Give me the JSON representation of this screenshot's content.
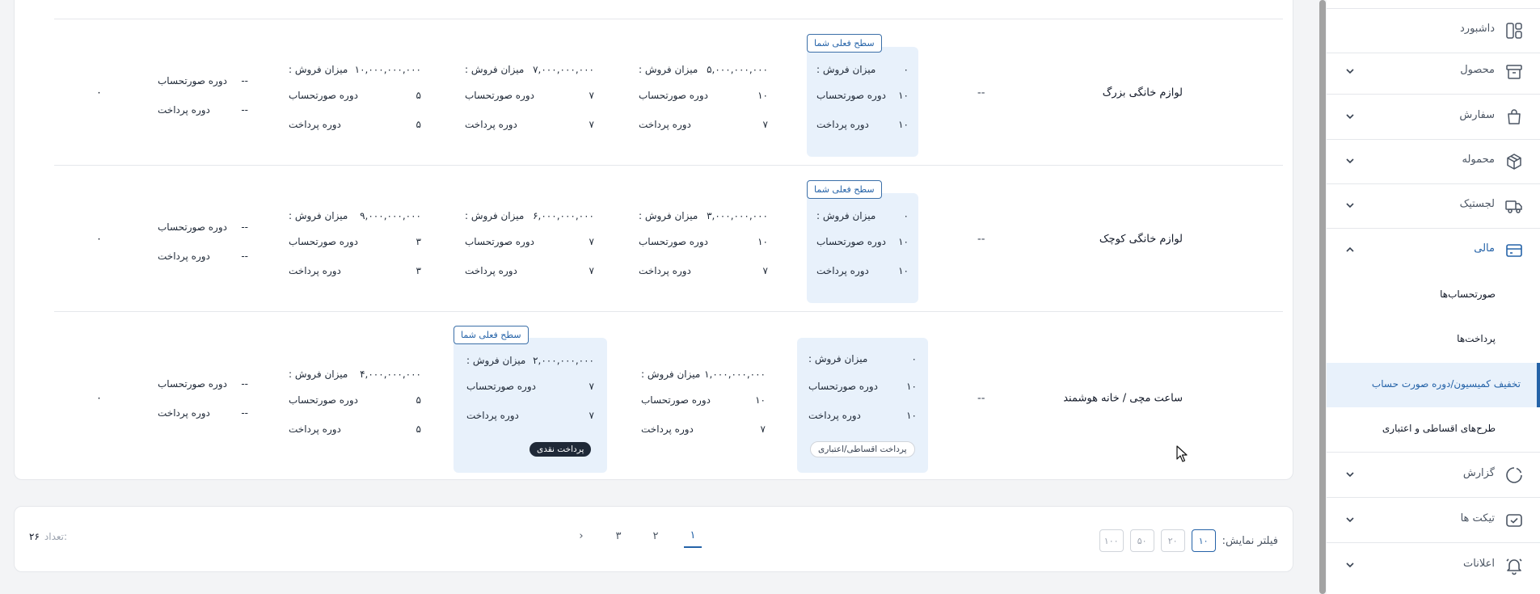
{
  "sidebar": {
    "items": [
      {
        "label": "داشبورد",
        "icon": "dashboard-icon"
      },
      {
        "label": "محصول",
        "icon": "product-icon"
      },
      {
        "label": "سفارش",
        "icon": "order-bag-icon"
      },
      {
        "label": "محموله",
        "icon": "package-icon"
      },
      {
        "label": "لجستیک",
        "icon": "truck-icon"
      },
      {
        "label": "مالی",
        "icon": "wallet-icon"
      }
    ],
    "finance_sub": [
      {
        "label": "صورتحساب‌ها"
      },
      {
        "label": "پرداخت‌ها"
      },
      {
        "label": "تخفیف کمیسیون/دوره صورت حساب"
      },
      {
        "label": "طرح‌های اقساطی و اعتباری"
      }
    ],
    "bottom_items": [
      {
        "label": "گزارش",
        "icon": "report-icon"
      },
      {
        "label": "تیکت ها",
        "icon": "ticket-icon"
      },
      {
        "label": "اعلانات",
        "icon": "bell-icon"
      }
    ]
  },
  "labels": {
    "sales": "میزان فروش :",
    "billing_period": "دوره صورتحساب",
    "payment_period": "دوره پرداخت",
    "current_level": "سطح فعلی شما",
    "cash_payment": "پرداخت نقدی",
    "installment_payment": "پرداخت اقساطی/اعتباری",
    "empty": "--"
  },
  "rows": [
    {
      "product": "لوازم خانگی بزرگ",
      "commission": "--",
      "final": "۰",
      "tiers": [
        {
          "sales": "۰",
          "billing": "۱۰",
          "payment": "۱۰"
        },
        {
          "sales": "۵,۰۰۰,۰۰۰,۰۰۰",
          "billing": "۱۰",
          "payment": "۷"
        },
        {
          "sales": "۷,۰۰۰,۰۰۰,۰۰۰",
          "billing": "۷",
          "payment": "۷"
        },
        {
          "sales": "۱۰,۰۰۰,۰۰۰,۰۰۰",
          "billing": "۵",
          "payment": "۵"
        },
        {
          "sales": "",
          "billing": "--",
          "payment": "--"
        }
      ]
    },
    {
      "product": "لوازم خانگی کوچک",
      "commission": "--",
      "final": "۰",
      "tiers": [
        {
          "sales": "۰",
          "billing": "۱۰",
          "payment": "۱۰"
        },
        {
          "sales": "۳,۰۰۰,۰۰۰,۰۰۰",
          "billing": "۱۰",
          "payment": "۷"
        },
        {
          "sales": "۶,۰۰۰,۰۰۰,۰۰۰",
          "billing": "۷",
          "payment": "۷"
        },
        {
          "sales": "۹,۰۰۰,۰۰۰,۰۰۰",
          "billing": "۳",
          "payment": "۳"
        },
        {
          "sales": "",
          "billing": "--",
          "payment": "--"
        }
      ]
    },
    {
      "product": "ساعت مچی / خانه هوشمند",
      "commission": "--",
      "final": "۰",
      "tiers": [
        {
          "sales": "۰",
          "billing": "۱۰",
          "payment": "۱۰"
        },
        {
          "sales": "۱,۰۰۰,۰۰۰,۰۰۰",
          "billing": "۱۰",
          "payment": "۷"
        },
        {
          "sales": "۲,۰۰۰,۰۰۰,۰۰۰",
          "billing": "۷",
          "payment": "۷"
        },
        {
          "sales": "۴,۰۰۰,۰۰۰,۰۰۰",
          "billing": "۵",
          "payment": "۵"
        },
        {
          "sales": "",
          "billing": "--",
          "payment": "--"
        }
      ]
    }
  ],
  "pagination": {
    "filter_label": "فیلتر نمایش:",
    "page_sizes": [
      "۱۰",
      "۲۰",
      "۵۰",
      "۱۰۰"
    ],
    "pages": [
      "۱",
      "۲",
      "۳"
    ],
    "next": "›",
    "count_label": "تعداد:",
    "count": "۲۶"
  },
  "colors": {
    "accent": "#2563a8",
    "highlight": "#e8f1fb"
  }
}
